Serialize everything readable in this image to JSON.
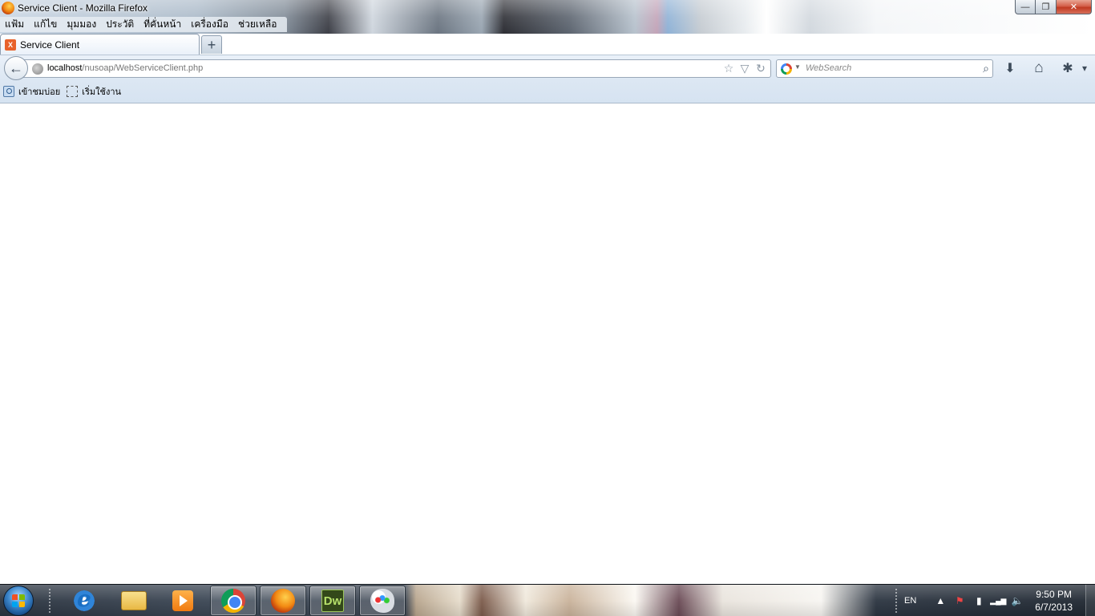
{
  "window": {
    "title": "Service Client - Mozilla Firefox",
    "controls": {
      "minimize": "—",
      "maximize": "❐",
      "close": "✕"
    }
  },
  "menu": [
    "แฟ้ม",
    "แก้ไข",
    "มุมมอง",
    "ประวัติ",
    "ที่คั่นหน้า",
    "เครื่องมือ",
    "ช่วยเหลือ"
  ],
  "tabs": [
    {
      "title": "Service Client",
      "favicon": "X",
      "active": true
    }
  ],
  "new_tab_label": "+",
  "navigation": {
    "back_icon": "←",
    "url_host": "localhost",
    "url_path": "/nusoap/WebServiceClient.php",
    "bookmark_star_icon": "☆",
    "history_dropdown_icon": "▽",
    "reload_icon": "↻",
    "search_placeholder": "WebSearch",
    "search_engine_dropdown": "▼",
    "search_go_icon": "⌕",
    "downloads_icon": "⬇",
    "home_icon": "⌂",
    "addon_icon": "✱",
    "menu_dropdown_icon": "▾"
  },
  "bookmarks": [
    {
      "label": "เข้าชมบ่อย",
      "icon": "most-visited-icon"
    },
    {
      "label": "เริ่มใช้งาน",
      "icon": "getting-started-icon"
    }
  ],
  "taskbar": {
    "pinned": [
      "internet-explorer",
      "windows-explorer",
      "media-player",
      "chrome",
      "firefox",
      "dreamweaver",
      "paint"
    ],
    "active": "firefox",
    "language": "EN",
    "tray_icons": {
      "show_hidden": "▲",
      "action_center": "⚑",
      "power": "▮",
      "network": "▂▄▆",
      "volume": "🔈"
    },
    "time": "9:50 PM",
    "date": "6/7/2013"
  },
  "colors": {
    "chrome_bg": "#dce7f3",
    "tab_bg": "#eaf1f9",
    "firefox_orange": "#f28a13",
    "close_red": "#c03a22",
    "url_path_gray": "#777777"
  }
}
